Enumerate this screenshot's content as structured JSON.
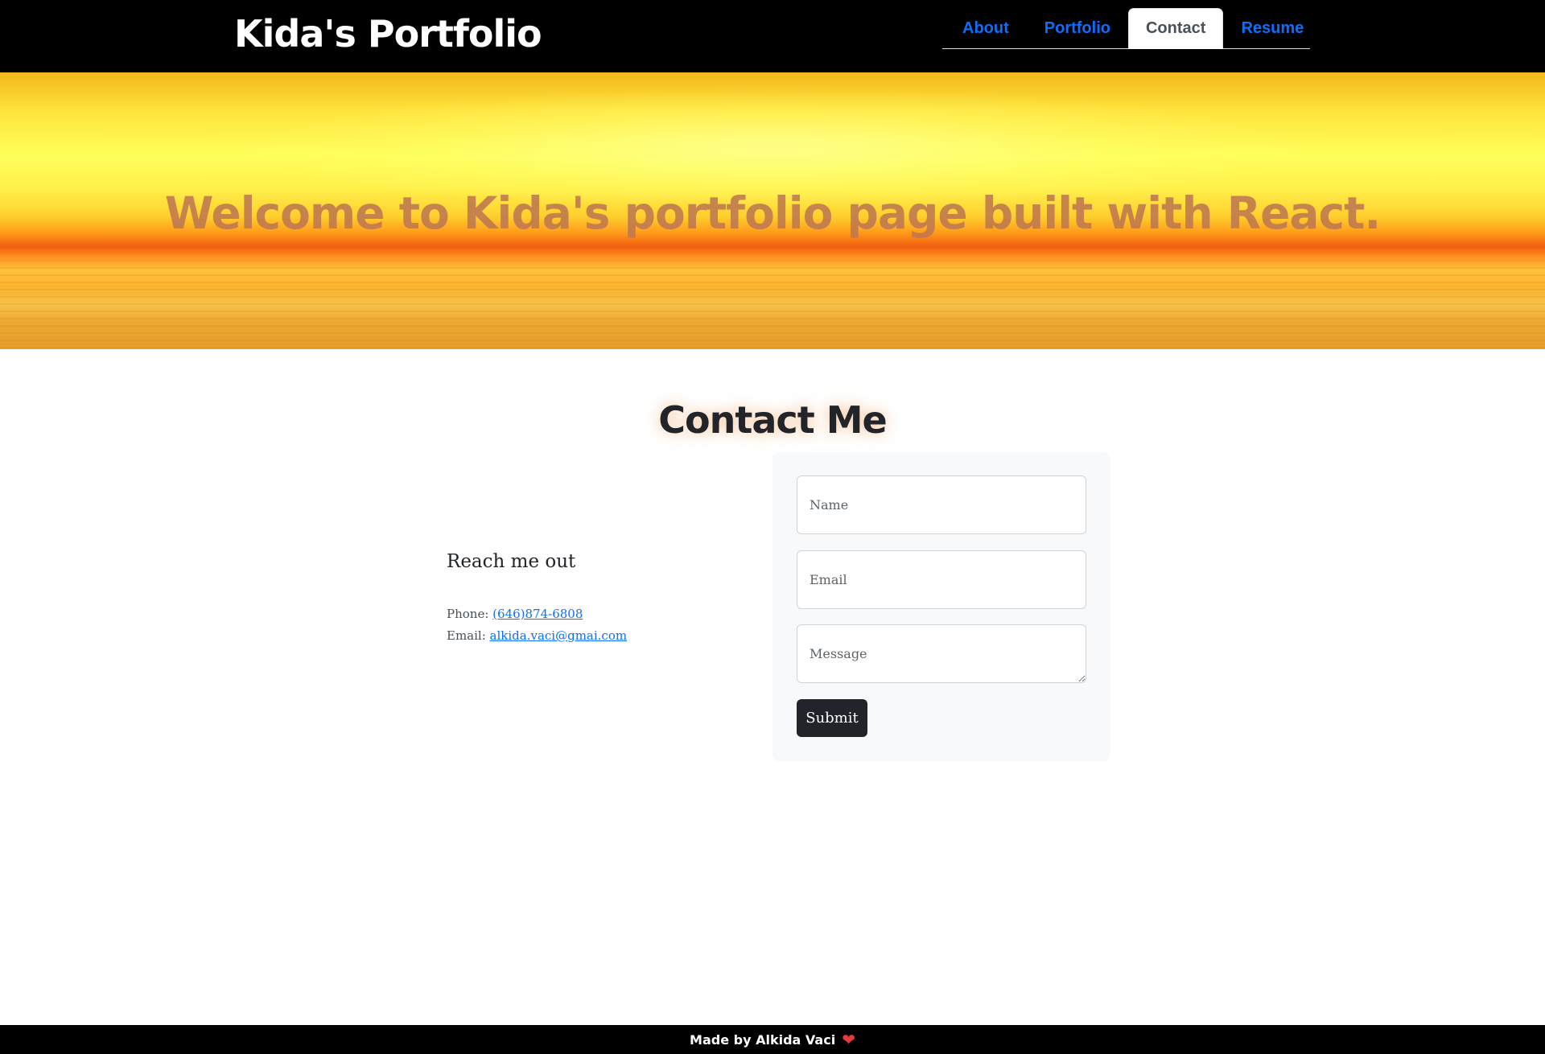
{
  "header": {
    "brand": "Kida's Portfolio",
    "tabs": [
      {
        "label": "About",
        "active": false
      },
      {
        "label": "Portfolio",
        "active": false
      },
      {
        "label": "Contact",
        "active": true
      },
      {
        "label": "Resume",
        "active": false
      }
    ]
  },
  "hero": {
    "title": "Welcome to Kida's portfolio page built with React."
  },
  "contact": {
    "title": "Contact Me",
    "reach": "Reach me out",
    "phone_label": "Phone:",
    "phone_value": "(646)874-6808",
    "email_label": "Email:",
    "email_value": "alkida.vaci@gmai.com"
  },
  "form": {
    "name_placeholder": "Name",
    "email_placeholder": "Email",
    "message_placeholder": "Message",
    "submit_label": "Submit"
  },
  "footer": {
    "text": "Made by Alkida Vaci",
    "heart_icon": "heart-icon"
  },
  "colors": {
    "nav_link": "#0d6efd",
    "nav_active_text": "#495057",
    "button_bg": "#212529",
    "heart": "#e8383d"
  }
}
